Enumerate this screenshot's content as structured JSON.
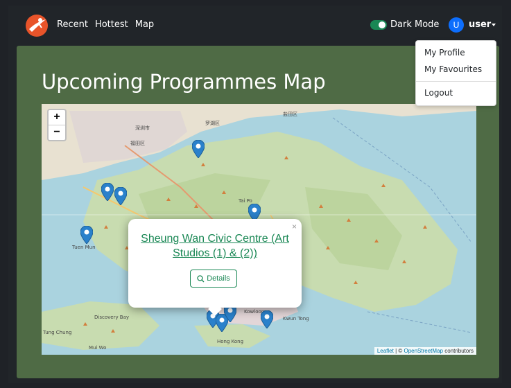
{
  "nav": {
    "links": [
      "Recent",
      "Hottest",
      "Map"
    ],
    "dark_mode_label": "Dark Mode",
    "avatar_initial": "U",
    "user_name": "user"
  },
  "dropdown": {
    "items": [
      "My Profile",
      "My Favourites",
      "Logout"
    ]
  },
  "page": {
    "title": "Upcoming Programmes Map"
  },
  "map": {
    "zoom_in": "+",
    "zoom_out": "−",
    "attribution": {
      "leaflet": "Leaflet",
      "separator": " | © ",
      "osm": "OpenStreetMap",
      "suffix": " contributors"
    },
    "labels": [
      "深圳市",
      "福田区",
      "罗湖区",
      "盐田区",
      "Tuen Mun",
      "Tai Po",
      "Kowloon",
      "Hong Kong",
      "Discovery Bay",
      "Tung Chung",
      "Mui Wo",
      "Kwun Tong"
    ],
    "popup": {
      "title": "Sheung Wan Civic Centre (Art Studios (1) & (2))",
      "close": "×",
      "details_label": "Details"
    }
  },
  "colors": {
    "accent": "#198754",
    "card_bg": "#4f6b45",
    "navbar_bg": "#212529",
    "marker": "#2a81cb",
    "avatar": "#0d6efd"
  }
}
